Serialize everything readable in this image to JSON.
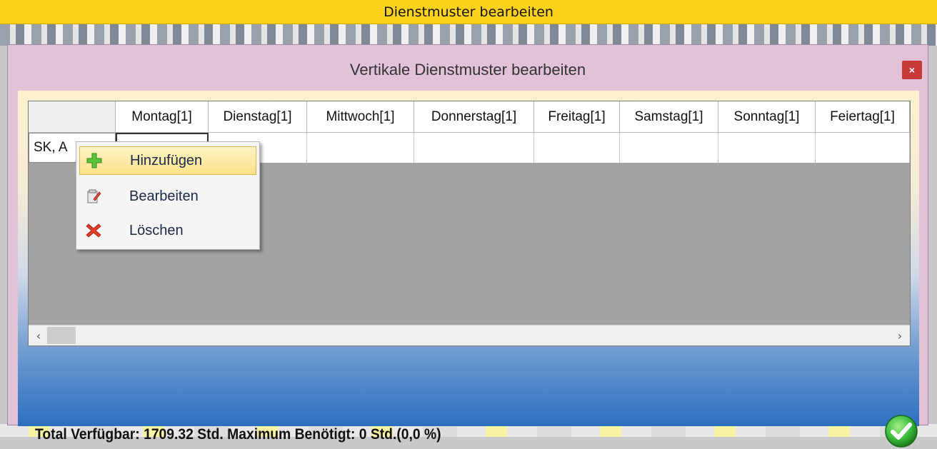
{
  "outer": {
    "title": "Dienstmuster bearbeiten"
  },
  "dialog": {
    "title": "Vertikale Dienstmuster bearbeiten",
    "close_label": "×"
  },
  "grid": {
    "columns": [
      "Montag[1]",
      "Dienstag[1]",
      "Mittwoch[1]",
      "Donnerstag[1]",
      "Freitag[1]",
      "Samstag[1]",
      "Sonntag[1]",
      "Feiertag[1]"
    ],
    "rows": [
      {
        "label": "SK, A"
      }
    ]
  },
  "context_menu": {
    "items": [
      {
        "label": "Hinzufügen",
        "icon": "plus-icon"
      },
      {
        "label": "Bearbeiten",
        "icon": "edit-icon"
      },
      {
        "label": "Löschen",
        "icon": "delete-icon"
      }
    ]
  },
  "scrollbar": {
    "left_arrow": "‹",
    "right_arrow": "›"
  },
  "footer": {
    "status": "Total Verfügbar: 1709.32 Std.  Maximum Benötigt: 0 Std.(0,0 %)"
  },
  "colors": {
    "outer_title_bg": "#ffd21c",
    "dialog_bg": "#e2c2d6",
    "close_button": "#c63a3a",
    "menu_highlight": "#fde28a",
    "ok_green": "#3fbf3f"
  }
}
